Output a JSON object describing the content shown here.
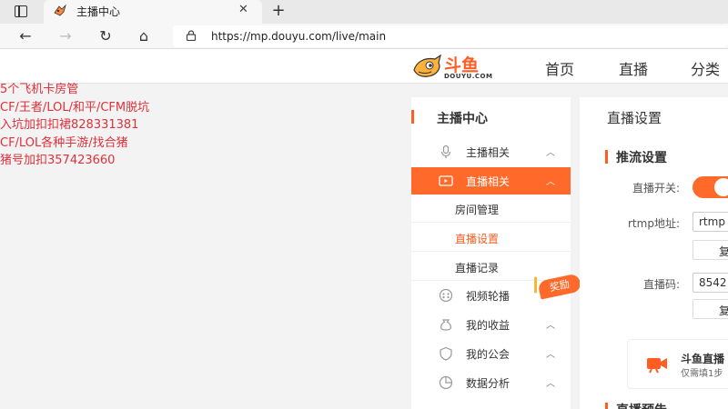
{
  "browser": {
    "tab": {
      "title": "主播中心",
      "close": "✕"
    },
    "new_tab": "+",
    "nav": {
      "back": "←",
      "forward": "→",
      "reload": "↻",
      "home": "⌂"
    },
    "url": "https://mp.douyu.com/live/main"
  },
  "site": {
    "logo": {
      "text": "斗鱼",
      "sub": "DOUYU.COM"
    },
    "top_nav": [
      "首页",
      "直播",
      "分类"
    ]
  },
  "overlay_text": [
    "5个飞机卡房管",
    "CF/王者/LOL/和平/CFM脱坑",
    "入坑加扣扣裙828331381",
    "CF/LOL各种手游/找合猪",
    "猪号加扣357423660"
  ],
  "sidebar": {
    "title": "主播中心",
    "items": [
      {
        "label": "主播相关",
        "chevron": "︿",
        "icon": "microphone-icon"
      },
      {
        "label": "直播相关",
        "chevron": "︿",
        "icon": "live-camera-icon",
        "active": true
      },
      {
        "label": "视频轮播",
        "chevron": "",
        "icon": "video-reel-icon"
      },
      {
        "label": "我的收益",
        "chevron": "︿",
        "icon": "money-bag-icon"
      },
      {
        "label": "我的公会",
        "chevron": "︿",
        "icon": "shield-icon"
      },
      {
        "label": "数据分析",
        "chevron": "︿",
        "icon": "pie-chart-icon"
      }
    ],
    "sub_items": [
      {
        "label": "房间管理"
      },
      {
        "label": "直播设置",
        "selected": true
      },
      {
        "label": "直播记录"
      }
    ],
    "reward_badge": "奖励"
  },
  "content": {
    "page_title": "直播设置",
    "section_push": "推流设置",
    "switch_label": "直播开关:",
    "rtmp_label": "rtmp地址:",
    "rtmp_value": "rtmp",
    "copy_label": "复",
    "code_label": "直播码:",
    "code_value": "8542",
    "promo_title": "斗鱼直播",
    "promo_sub": "仅需填1步",
    "section_preview": "直播预告"
  },
  "colors": {
    "accent": "#ff6a2b",
    "overlay_text": "#e0303a"
  }
}
